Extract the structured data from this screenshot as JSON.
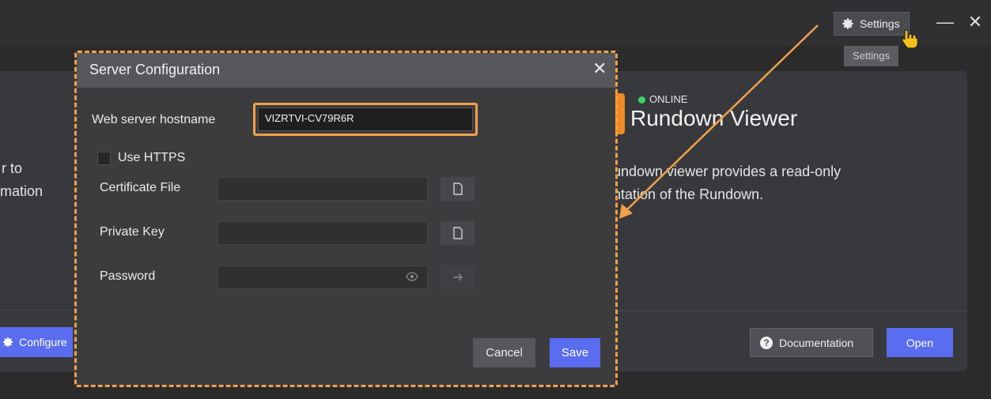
{
  "window": {
    "settings_label": "Settings",
    "tooltip": "Settings",
    "minimize_glyph": "—",
    "close_glyph": "✕"
  },
  "left_card": {
    "line1": "r to",
    "line2": "mation",
    "configure_label": "Configure"
  },
  "right_card": {
    "status": "ONLINE",
    "title": "Rundown Viewer",
    "desc_line1": "undown viewer provides a read-only",
    "desc_line2": "ntation of the Rundown.",
    "documentation_label": "Documentation",
    "documentation_icon_glyph": "?",
    "open_label": "Open"
  },
  "modal": {
    "title": "Server Configuration",
    "close_glyph": "✕",
    "hostname_label": "Web server hostname",
    "hostname_value": "VIZRTVI-CV79R6R",
    "https_label": "Use HTTPS",
    "certificate_label": "Certificate File",
    "private_key_label": "Private Key",
    "password_label": "Password",
    "cancel_label": "Cancel",
    "save_label": "Save"
  },
  "colors": {
    "accent": "#5a6cf0",
    "highlight": "#f2a04a",
    "online": "#3bd16a",
    "status_tab": "#f08b24"
  },
  "icons": [
    "gear-icon",
    "hand-cursor-icon",
    "minimize-icon",
    "close-icon",
    "file-icon",
    "eye-icon",
    "arrow-right-icon",
    "help-icon"
  ]
}
